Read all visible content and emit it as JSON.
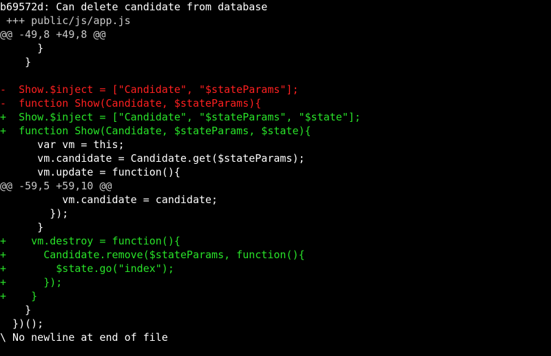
{
  "colors": {
    "background": "#000000",
    "text": "#ffffff",
    "meta": "#c9c9c9",
    "deleted": "#ff2020",
    "added": "#29e329"
  },
  "commit_header": "b69572d: Can delete candidate from database",
  "diff": {
    "file_header": " +++ public/js/app.js",
    "hunk1_header": "@@ -49,8 +49,8 @@",
    "hunk1_lines": [
      "      }",
      "    }",
      "",
      "-  Show.$inject = [\"Candidate\", \"$stateParams\"];",
      "-  function Show(Candidate, $stateParams){",
      "+  Show.$inject = [\"Candidate\", \"$stateParams\", \"$state\"];",
      "+  function Show(Candidate, $stateParams, $state){",
      "      var vm = this;",
      "      vm.candidate = Candidate.get($stateParams);",
      "      vm.update = function(){"
    ],
    "hunk2_header": "@@ -59,5 +59,10 @@",
    "hunk2_lines": [
      "          vm.candidate = candidate;",
      "        });",
      "      }",
      "+    vm.destroy = function(){",
      "+      Candidate.remove($stateParams, function(){",
      "+        $state.go(\"index\");",
      "+      });",
      "+    }",
      "    }",
      "  })();"
    ],
    "no_newline_note": "\\ No newline at end of file"
  }
}
